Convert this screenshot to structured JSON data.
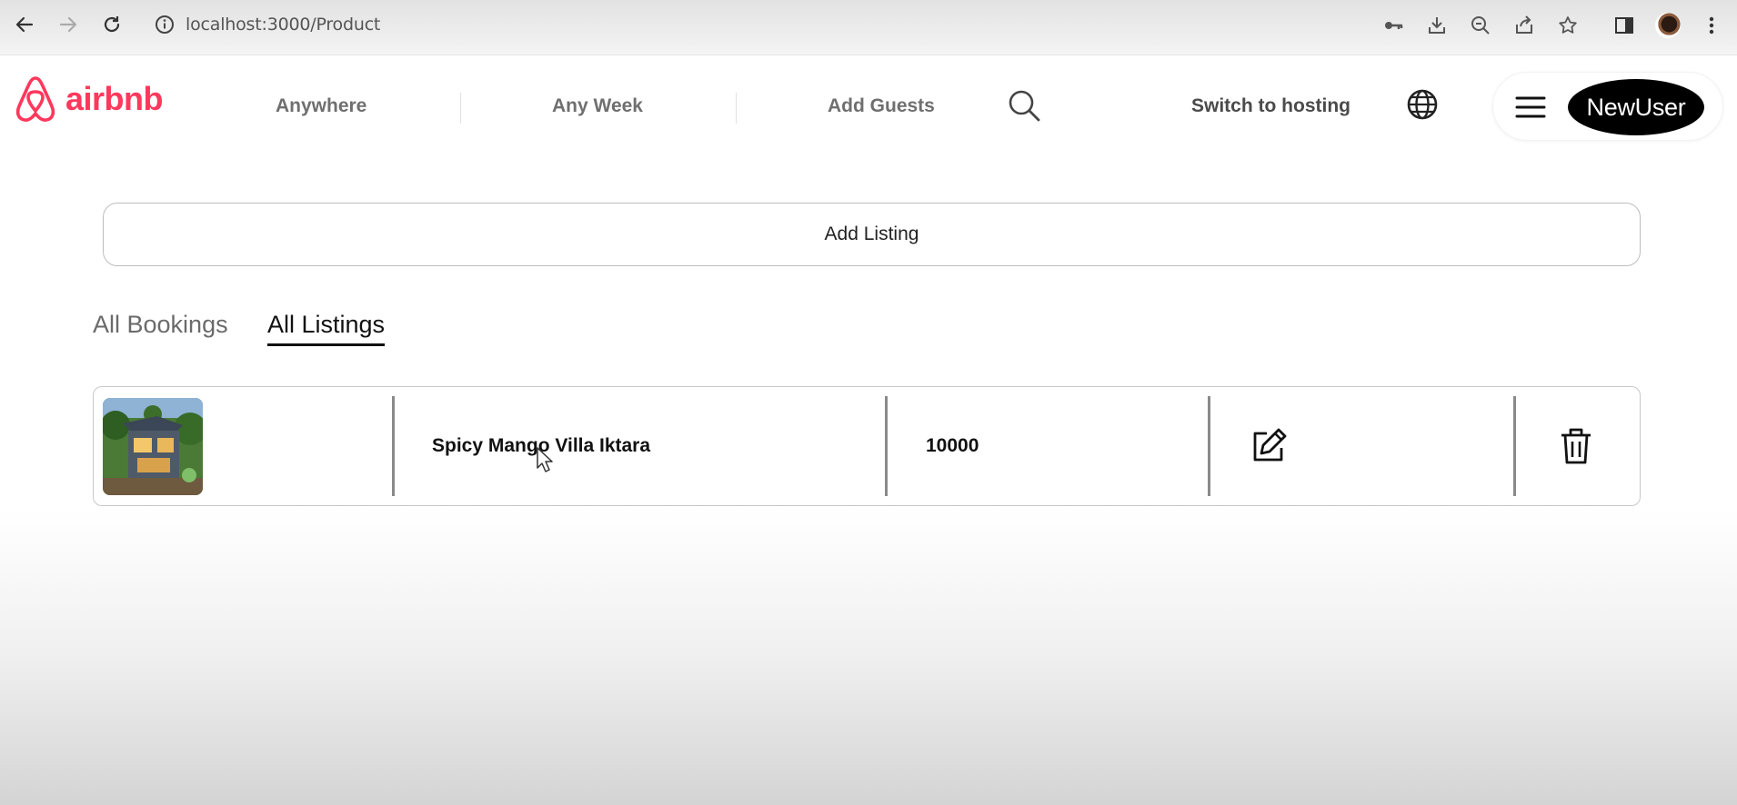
{
  "browser": {
    "url": "localhost:3000/Product",
    "icons": [
      "back-arrow-icon",
      "forward-arrow-icon",
      "reload-icon",
      "info-icon",
      "key-icon",
      "download-icon",
      "zoom-out-icon",
      "share-icon",
      "star-icon",
      "sidebar-icon",
      "profile-avatar",
      "kebab-menu-icon"
    ]
  },
  "header": {
    "logo_text": "airbnb",
    "brand_color": "#ff385c",
    "search": {
      "where": "Anywhere",
      "when": "Any Week",
      "guests": "Add Guests"
    },
    "switch_hosting": "Switch to hosting",
    "user_name": "NewUser"
  },
  "main": {
    "add_listing_label": "Add Listing",
    "tabs": [
      {
        "label": "All Bookings",
        "active": false
      },
      {
        "label": "All Listings",
        "active": true
      }
    ],
    "listings": [
      {
        "title": "Spicy Mango Villa Iktara",
        "price": "10000"
      }
    ]
  }
}
